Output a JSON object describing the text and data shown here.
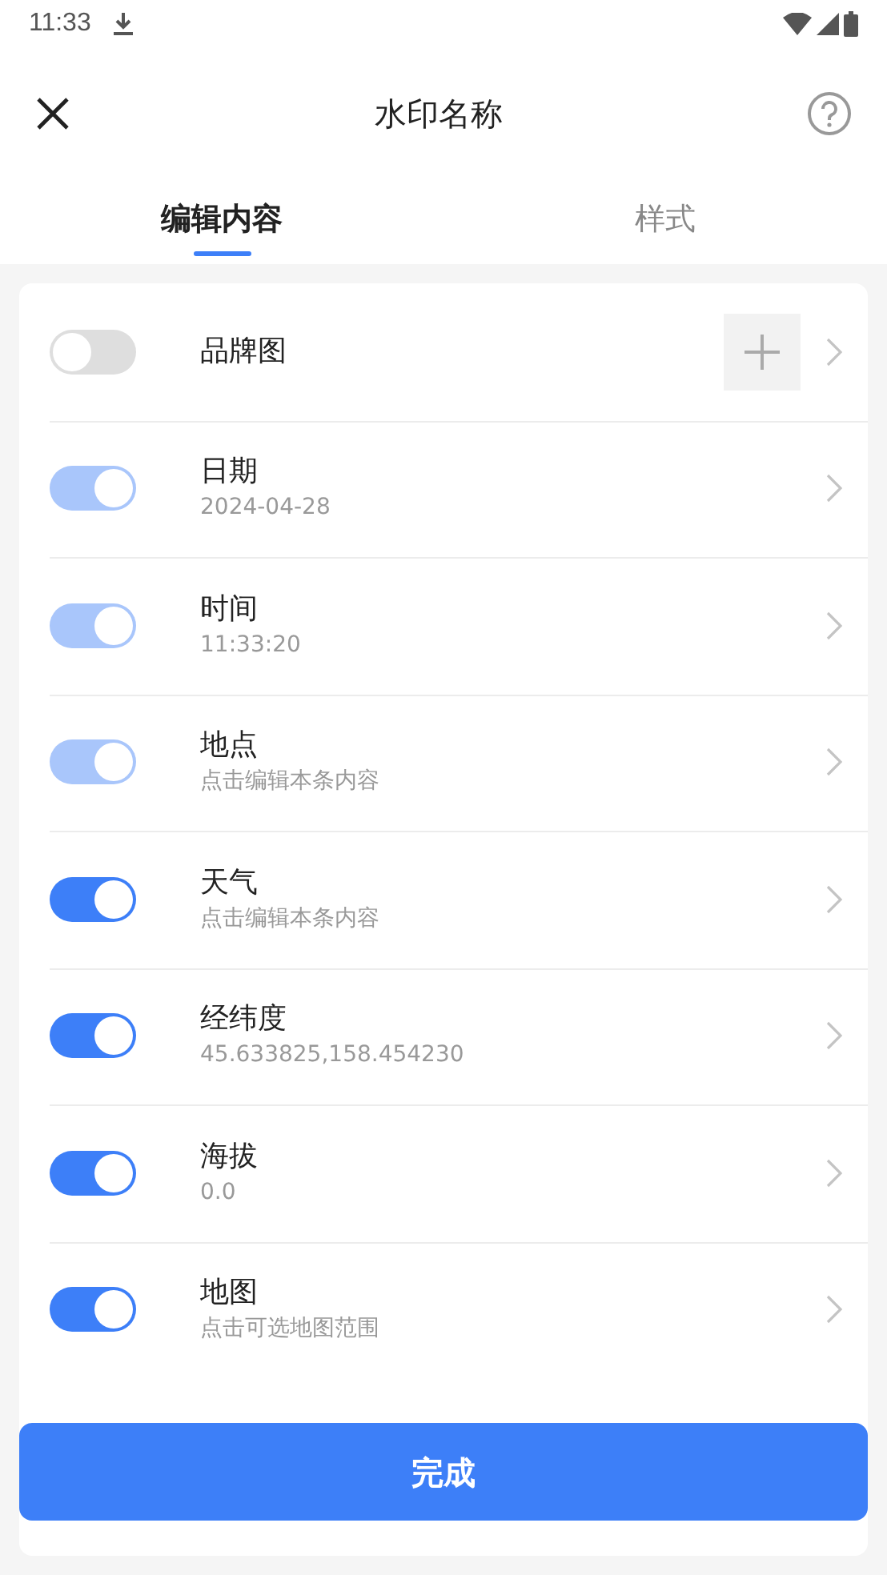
{
  "status_bar": {
    "time": "11:33"
  },
  "header": {
    "title": "水印名称"
  },
  "tabs": [
    {
      "label": "编辑内容",
      "selected": true
    },
    {
      "label": "样式",
      "selected": false
    }
  ],
  "items": [
    {
      "title": "品牌图",
      "on": false,
      "disabled": false,
      "add_image": true
    },
    {
      "title": "日期",
      "subtitle": "2024-04-28",
      "on": true,
      "disabled": true
    },
    {
      "title": "时间",
      "subtitle": "11:33:20",
      "on": true,
      "disabled": true
    },
    {
      "title": "地点",
      "subtitle": "点击编辑本条内容",
      "on": true,
      "disabled": true
    },
    {
      "title": "天气",
      "subtitle": "点击编辑本条内容",
      "on": true,
      "disabled": false
    },
    {
      "title": "经纬度",
      "subtitle": "45.633825,158.454230",
      "on": true,
      "disabled": false
    },
    {
      "title": "海拔",
      "subtitle": "0.0",
      "on": true,
      "disabled": false
    },
    {
      "title": "地图",
      "subtitle": "点击可选地图范围",
      "on": true,
      "disabled": false
    }
  ],
  "done_button": "完成"
}
